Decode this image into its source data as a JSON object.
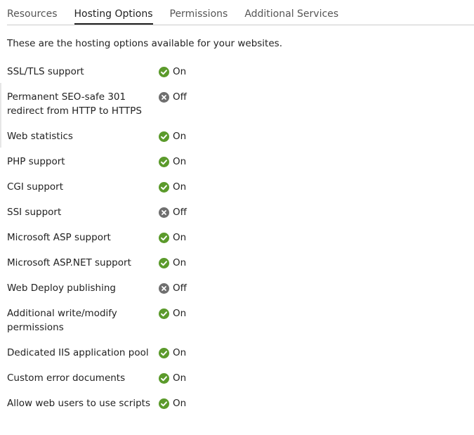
{
  "tabs": [
    {
      "label": "Resources",
      "active": false
    },
    {
      "label": "Hosting Options",
      "active": true
    },
    {
      "label": "Permissions",
      "active": false
    },
    {
      "label": "Additional Services",
      "active": false
    }
  ],
  "intro_text": "These are the hosting options available for your websites.",
  "colors": {
    "on": "#5b9a2b",
    "off": "#6f6f6f"
  },
  "options": [
    {
      "label": "SSL/TLS support",
      "status": "On",
      "icon": "check-circle-icon"
    },
    {
      "label": "Permanent SEO-safe 301 redirect from HTTP to HTTPS",
      "status": "Off",
      "icon": "x-circle-icon"
    },
    {
      "label": "Web statistics",
      "status": "On",
      "icon": "check-circle-icon"
    },
    {
      "label": "PHP support",
      "status": "On",
      "icon": "check-circle-icon"
    },
    {
      "label": "CGI support",
      "status": "On",
      "icon": "check-circle-icon"
    },
    {
      "label": "SSI support",
      "status": "Off",
      "icon": "x-circle-icon"
    },
    {
      "label": "Microsoft ASP support",
      "status": "On",
      "icon": "check-circle-icon"
    },
    {
      "label": "Microsoft ASP.NET support",
      "status": "On",
      "icon": "check-circle-icon"
    },
    {
      "label": "Web Deploy publishing",
      "status": "Off",
      "icon": "x-circle-icon"
    },
    {
      "label": "Additional write/modify permissions",
      "status": "On",
      "icon": "check-circle-icon"
    },
    {
      "label": "Dedicated IIS application pool",
      "status": "On",
      "icon": "check-circle-icon"
    },
    {
      "label": "Custom error documents",
      "status": "On",
      "icon": "check-circle-icon"
    },
    {
      "label": "Allow web users to use scripts",
      "status": "On",
      "icon": "check-circle-icon"
    }
  ]
}
